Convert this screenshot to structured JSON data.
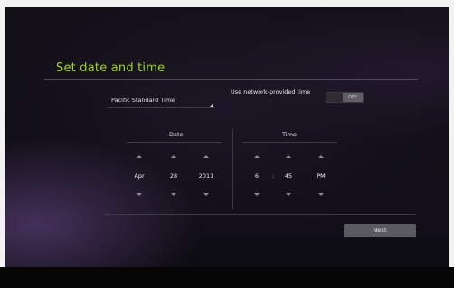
{
  "title": "Set date and time",
  "timezone": {
    "selected": "Pacific Standard Time"
  },
  "network_time": {
    "label": "Use network-provided time",
    "toggle_state": "OFF"
  },
  "date": {
    "label": "Date",
    "month": "Apr",
    "day": "28",
    "year": "2011"
  },
  "time": {
    "label": "Time",
    "hour": "6",
    "separator": ":",
    "minute": "45",
    "ampm": "PM"
  },
  "next_button_label": "Next",
  "colors": {
    "title_accent": "#9fd33a",
    "button_bg": "#5b5a60",
    "background": "#141018"
  }
}
